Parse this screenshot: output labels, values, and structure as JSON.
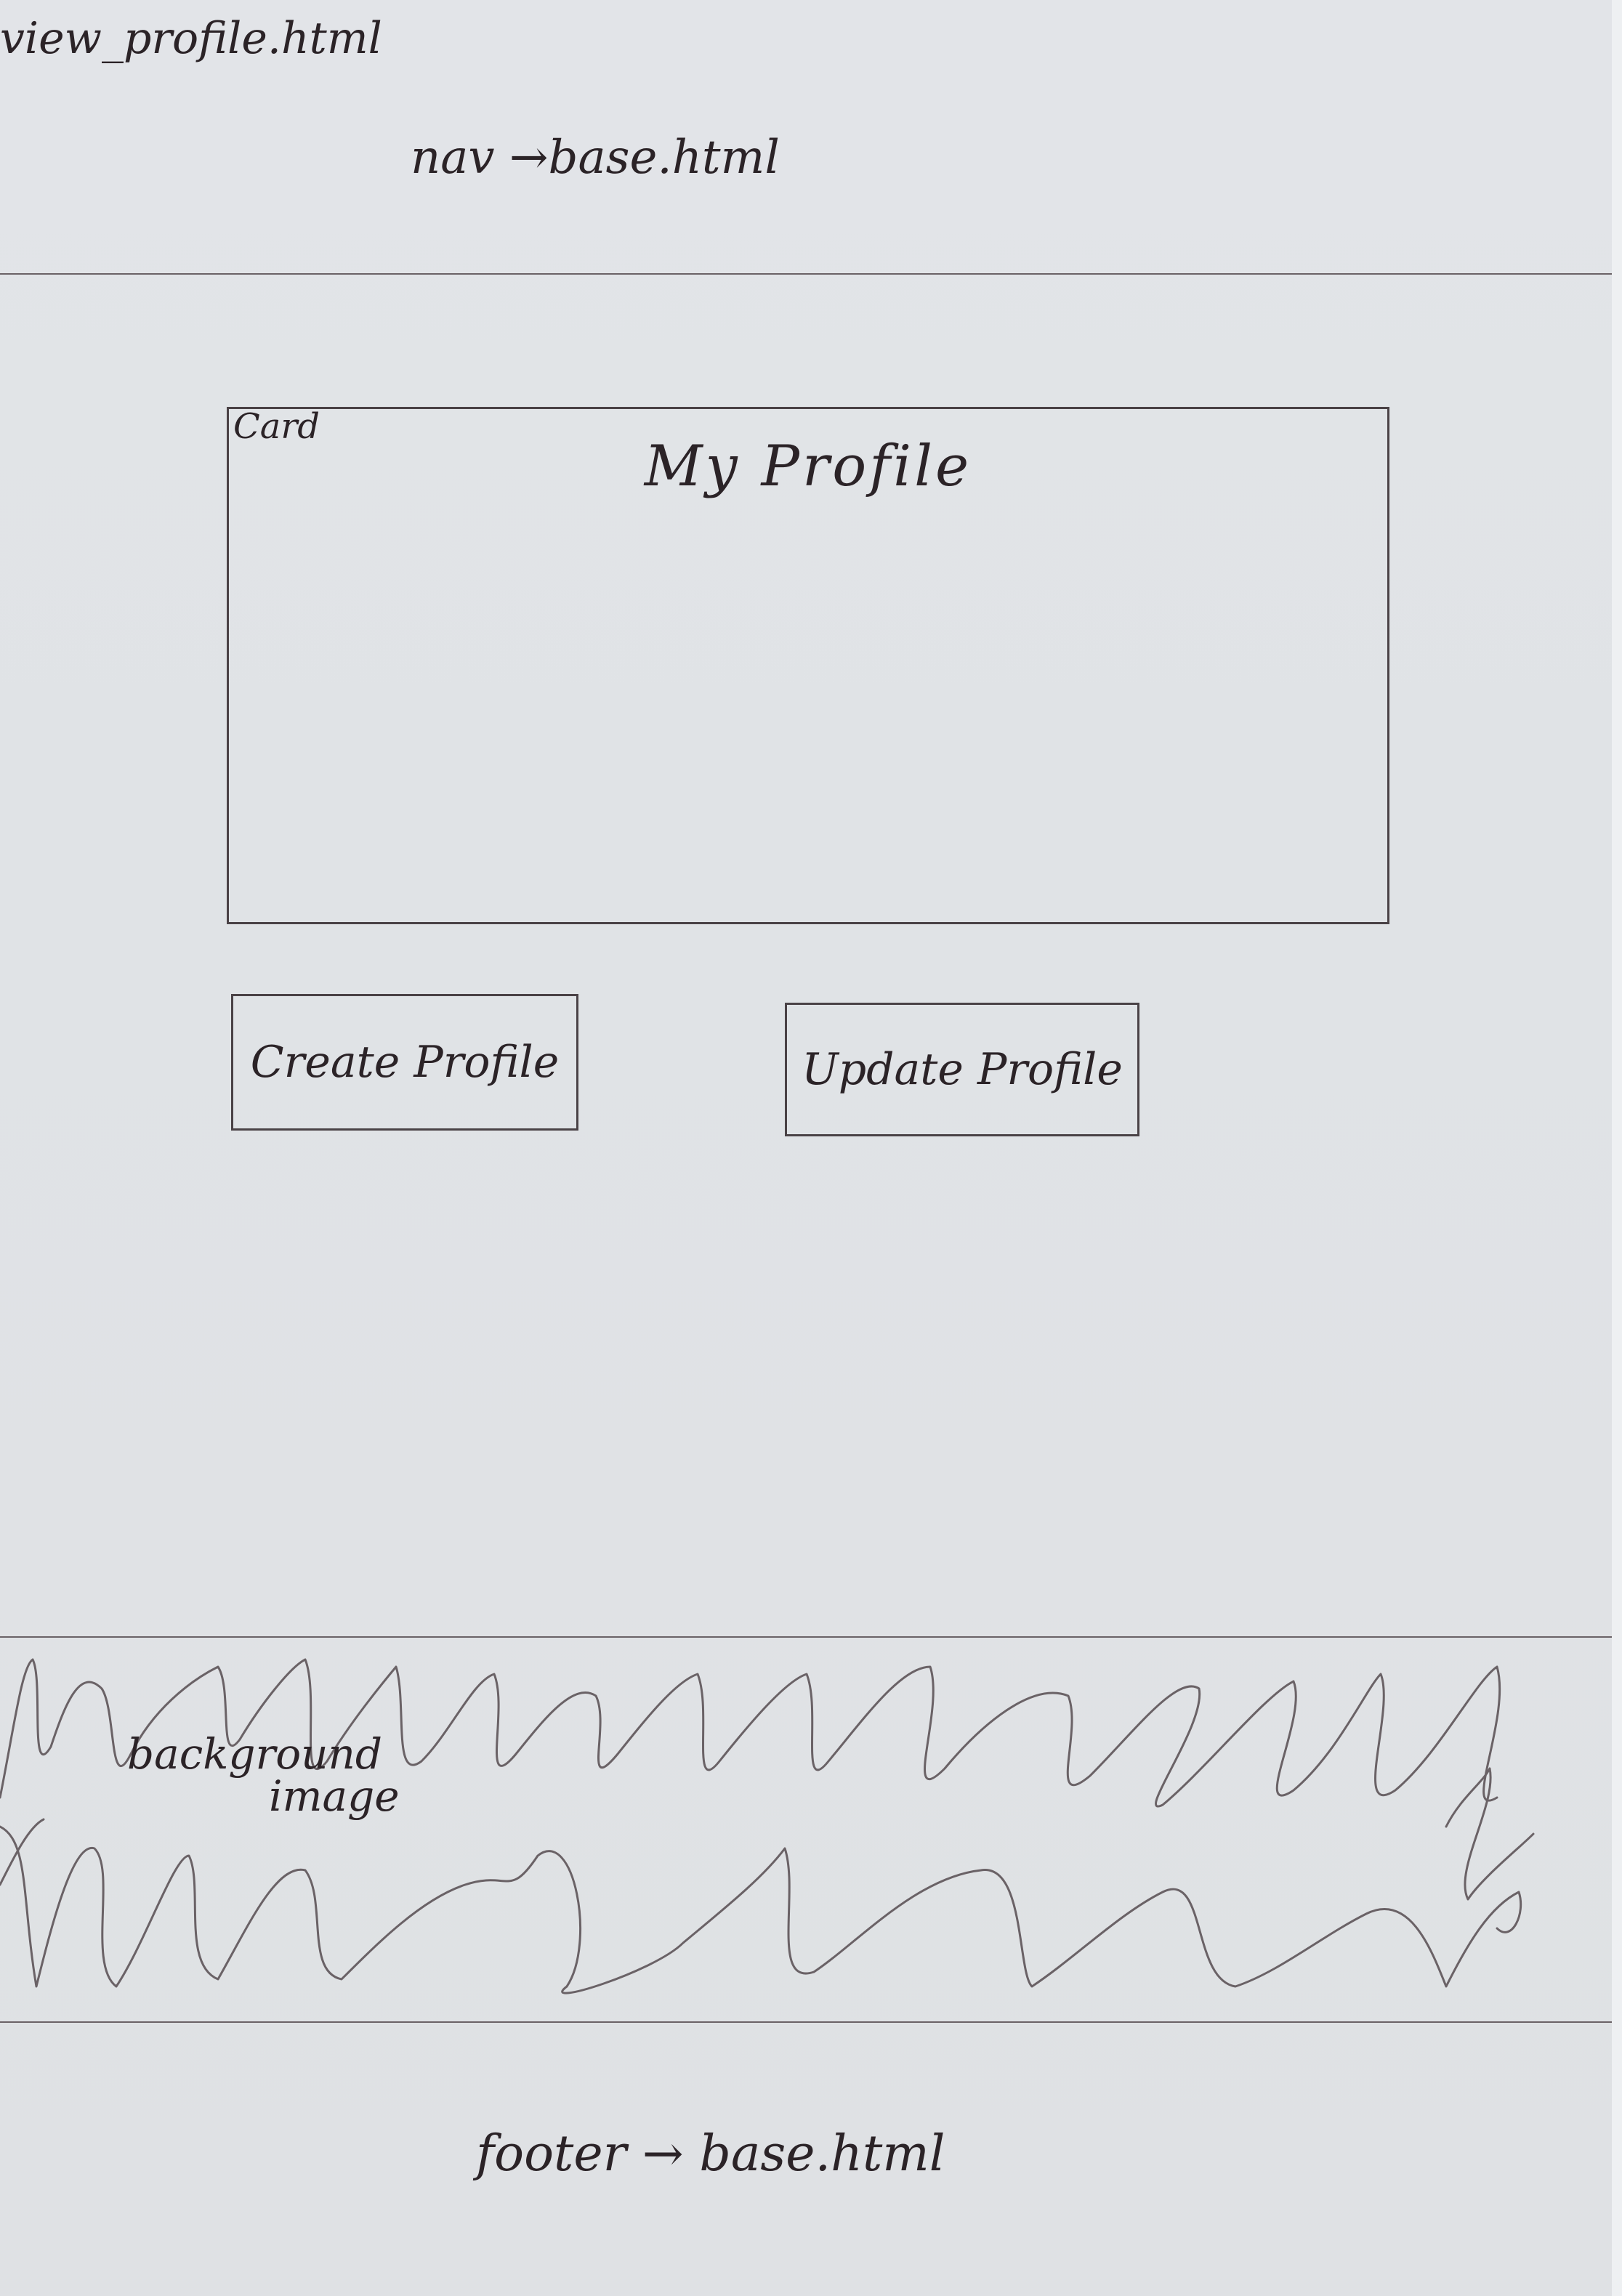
{
  "file_title": "view_profile.html",
  "nav": {
    "note": "nav →base.html"
  },
  "card": {
    "label": "Card",
    "title": "My Profile"
  },
  "buttons": {
    "create_label": "Create Profile",
    "update_label": "Update Profile"
  },
  "background": {
    "label_line1": "background",
    "label_line2": "image"
  },
  "footer": {
    "note": "footer → base.html"
  },
  "colors": {
    "paper": "#e2e4e8",
    "ink": "#2b2327",
    "pencil": "#6a6266"
  }
}
